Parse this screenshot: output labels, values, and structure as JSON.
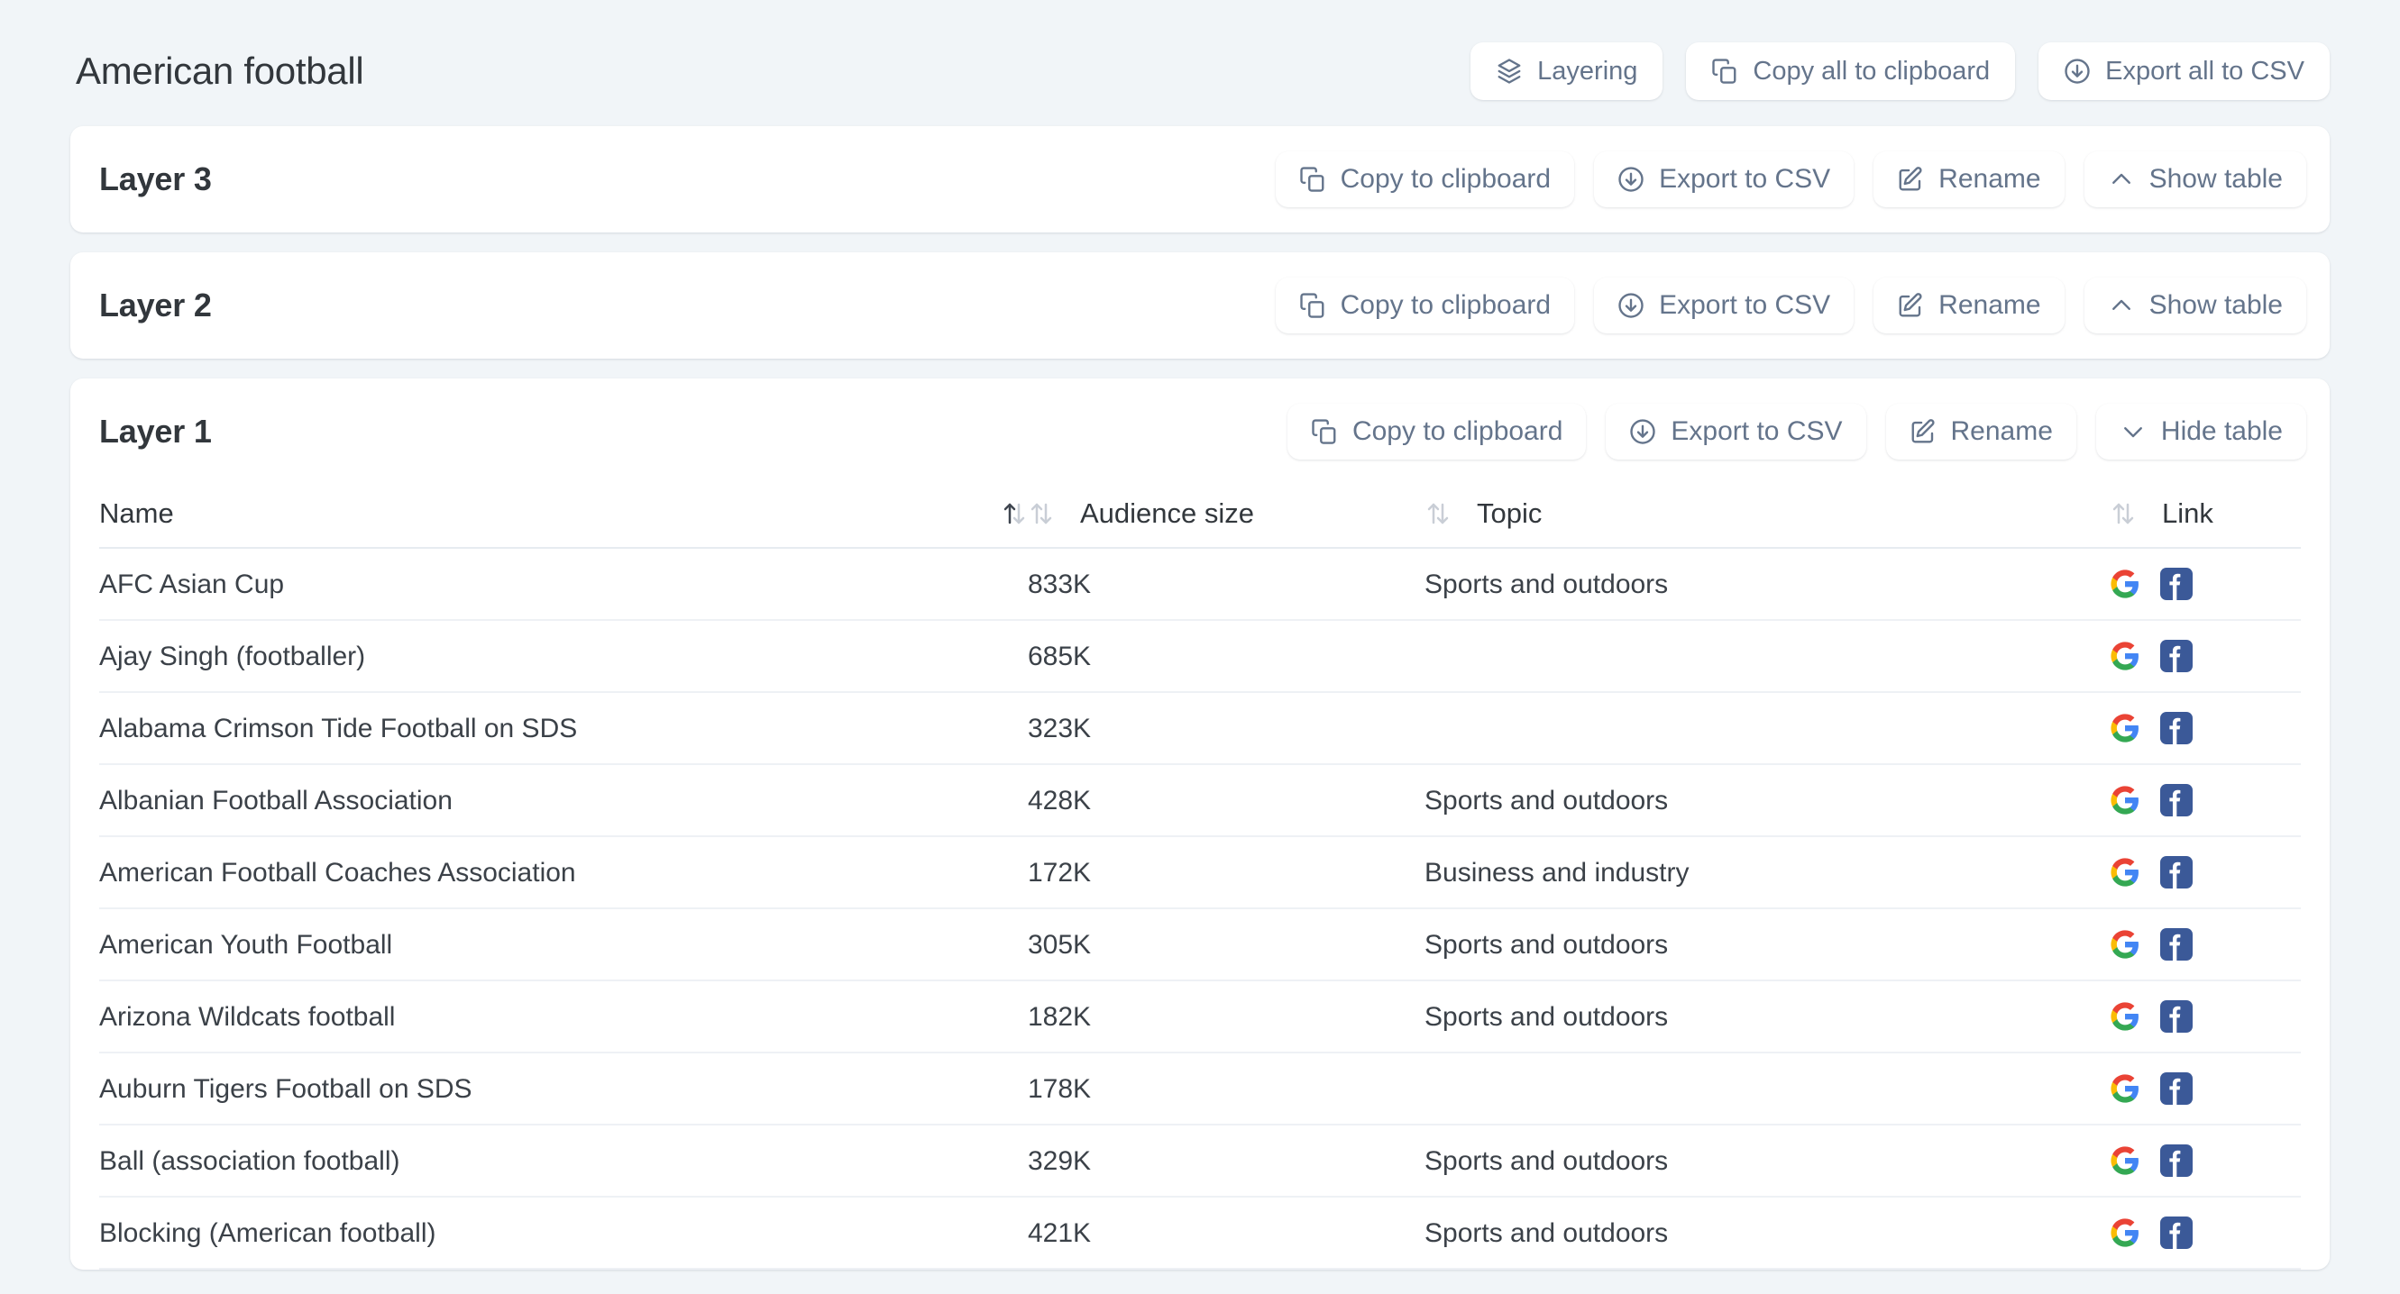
{
  "header": {
    "title": "American football",
    "actions": [
      {
        "id": "layering",
        "label": "Layering",
        "icon": "layers-icon"
      },
      {
        "id": "copy-all",
        "label": "Copy all to clipboard",
        "icon": "copy-icon"
      },
      {
        "id": "export-all",
        "label": "Export all to CSV",
        "icon": "download-icon"
      }
    ]
  },
  "buttons": {
    "copy": "Copy to clipboard",
    "export": "Export to CSV",
    "rename": "Rename",
    "show_table": "Show table",
    "hide_table": "Hide table"
  },
  "layers": [
    {
      "title": "Layer 3",
      "expanded": false,
      "toggle_label": "Show table"
    },
    {
      "title": "Layer 2",
      "expanded": false,
      "toggle_label": "Show table"
    },
    {
      "title": "Layer 1",
      "expanded": true,
      "toggle_label": "Hide table"
    }
  ],
  "table": {
    "columns": [
      {
        "key": "name",
        "label": "Name",
        "sortable": true,
        "sort": "asc",
        "sort_icon": "sort-arrows-icon"
      },
      {
        "key": "audience",
        "label": "Audience size",
        "sortable": true,
        "sort": "none",
        "sort_icon": "sort-arrows-icon"
      },
      {
        "key": "topic",
        "label": "Topic",
        "sortable": true,
        "sort": "none",
        "sort_icon": "sort-arrows-icon"
      },
      {
        "key": "link",
        "label": "Link",
        "sortable": true,
        "sort": "none",
        "sort_icon": "sort-arrows-icon"
      }
    ],
    "rows": [
      {
        "name": "AFC Asian Cup",
        "audience": "833K",
        "topic": "Sports and outdoors",
        "links": [
          "google-icon",
          "facebook-icon"
        ]
      },
      {
        "name": "Ajay Singh (footballer)",
        "audience": "685K",
        "topic": "",
        "links": [
          "google-icon",
          "facebook-icon"
        ]
      },
      {
        "name": "Alabama Crimson Tide Football on SDS",
        "audience": "323K",
        "topic": "",
        "links": [
          "google-icon",
          "facebook-icon"
        ]
      },
      {
        "name": "Albanian Football Association",
        "audience": "428K",
        "topic": "Sports and outdoors",
        "links": [
          "google-icon",
          "facebook-icon"
        ]
      },
      {
        "name": "American Football Coaches Association",
        "audience": "172K",
        "topic": "Business and industry",
        "links": [
          "google-icon",
          "facebook-icon"
        ]
      },
      {
        "name": "American Youth Football",
        "audience": "305K",
        "topic": "Sports and outdoors",
        "links": [
          "google-icon",
          "facebook-icon"
        ]
      },
      {
        "name": "Arizona Wildcats football",
        "audience": "182K",
        "topic": "Sports and outdoors",
        "links": [
          "google-icon",
          "facebook-icon"
        ]
      },
      {
        "name": "Auburn Tigers Football on SDS",
        "audience": "178K",
        "topic": "",
        "links": [
          "google-icon",
          "facebook-icon"
        ]
      },
      {
        "name": "Ball (association football)",
        "audience": "329K",
        "topic": "Sports and outdoors",
        "links": [
          "google-icon",
          "facebook-icon"
        ]
      },
      {
        "name": "Blocking (American football)",
        "audience": "421K",
        "topic": "Sports and outdoors",
        "links": [
          "google-icon",
          "facebook-icon"
        ]
      }
    ]
  },
  "colors": {
    "page_background": "#f1f5f8",
    "card_background": "#ffffff",
    "button_text": "#64748b",
    "title_text": "#32373c",
    "row_divider": "#eef1f5",
    "sort_active": "#3f4650",
    "sort_inactive": "#c9ced6",
    "facebook_blue": "#3b5998",
    "google_blue": "#4285f4",
    "google_red": "#ea4335",
    "google_yellow": "#fbbc05",
    "google_green": "#34a853"
  }
}
